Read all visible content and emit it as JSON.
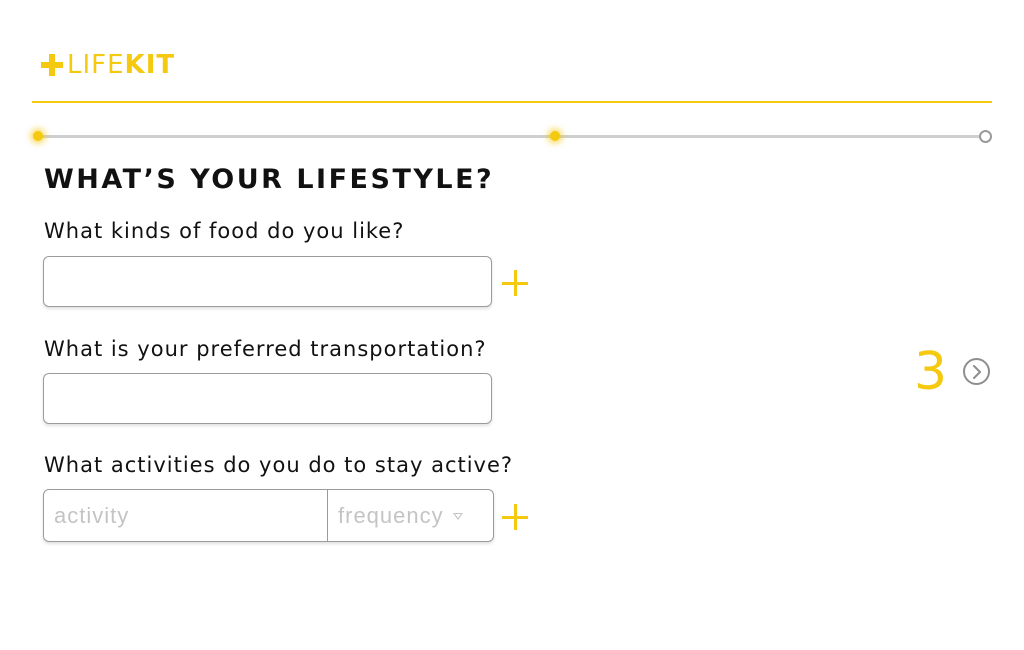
{
  "brand": {
    "logo_light": "LIFE",
    "logo_bold": "KIT",
    "accent_color": "#f4c90f"
  },
  "progress": {
    "steps_total": 3,
    "steps_completed": 2
  },
  "form": {
    "title": "WHAT’S YOUR LIFESTYLE?",
    "food": {
      "question": "What kinds of food do you like?",
      "value": "",
      "add_icon": "plus-icon"
    },
    "transport": {
      "question": "What is your preferred transportation?",
      "value": ""
    },
    "activity": {
      "question": "What activities do you do to stay active?",
      "activity_placeholder": "activity",
      "frequency_placeholder": "frequency",
      "add_icon": "plus-icon"
    }
  },
  "navigation": {
    "step_number": "3",
    "next_icon": "chevron-right-circle-icon"
  }
}
